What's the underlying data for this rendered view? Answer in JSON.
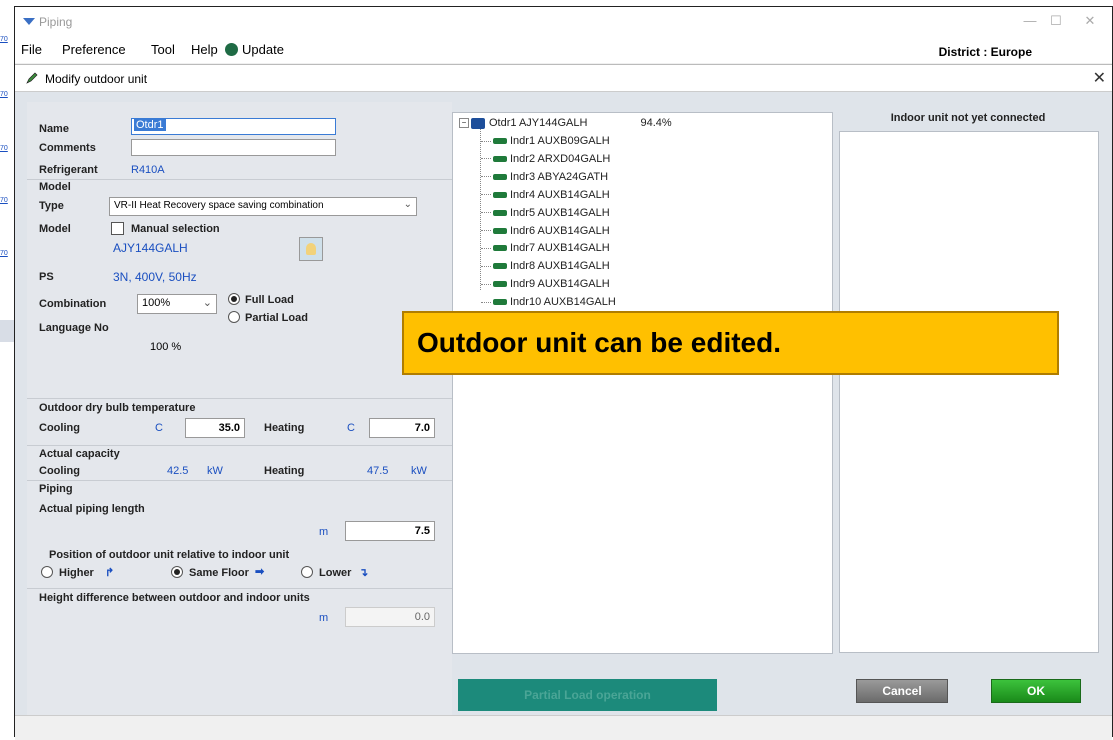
{
  "background_links": [
    "70",
    "70",
    "70",
    "70",
    "70"
  ],
  "window": {
    "title": "Piping",
    "district": "District : Europe"
  },
  "menu": {
    "file": "File",
    "preference": "Preference",
    "tool": "Tool",
    "help": "Help",
    "update": "Update"
  },
  "dialog": {
    "title": "Modify outdoor unit",
    "name_label": "Name",
    "name_value": "Otdr1",
    "comments_label": "Comments",
    "comments_value": "",
    "refrigerant_label": "Refrigerant",
    "refrigerant_value": "R410A",
    "model_section": "Model",
    "type_label": "Type",
    "type_value": "VR-II Heat Recovery space saving combination",
    "model_label": "Model",
    "manual_selection": "Manual selection",
    "model_value": "AJY144GALH",
    "ps_label": "PS",
    "ps_value": "3N, 400V, 50Hz",
    "combination_label": "Combination",
    "combination_value": "100%",
    "full_load": "Full Load",
    "partial_load": "Partial Load",
    "language_label": "Language No",
    "language_value": "100 %",
    "outdoor_temp_section": "Outdoor dry bulb temperature",
    "cooling_label": "Cooling",
    "c_unit": "C",
    "cooling_temp": "35.0",
    "heating_label": "Heating",
    "heating_temp": "7.0",
    "actual_capacity_section": "Actual capacity",
    "cooling_capacity": "42.5",
    "heating_capacity": "47.5",
    "kw_unit": "kW",
    "piping_section": "Piping",
    "piping_length_label": "Actual piping length",
    "m_unit": "m",
    "piping_length": "7.5",
    "position_label": "Position of outdoor unit relative to indoor unit",
    "higher": "Higher",
    "same_floor": "Same Floor",
    "lower": "Lower",
    "height_diff_label": "Height difference between outdoor and indoor units",
    "height_diff_value": "0.0"
  },
  "tree": {
    "root": {
      "label": "Otdr1  AJY144GALH",
      "percent": "94.4%"
    },
    "children": [
      "Indr1  AUXB09GALH",
      "Indr2  ARXD04GALH",
      "Indr3  ABYA24GATH",
      "Indr4  AUXB14GALH",
      "Indr5  AUXB14GALH",
      "Indr6  AUXB14GALH",
      "Indr7  AUXB14GALH",
      "Indr8  AUXB14GALH",
      "Indr9  AUXB14GALH",
      "Indr10  AUXB14GALH"
    ]
  },
  "right_panel": {
    "header": "Indoor unit not yet connected"
  },
  "callout": "Outdoor unit can be edited.",
  "buttons": {
    "partial": "Partial Load operation",
    "cancel": "Cancel",
    "ok": "OK"
  }
}
